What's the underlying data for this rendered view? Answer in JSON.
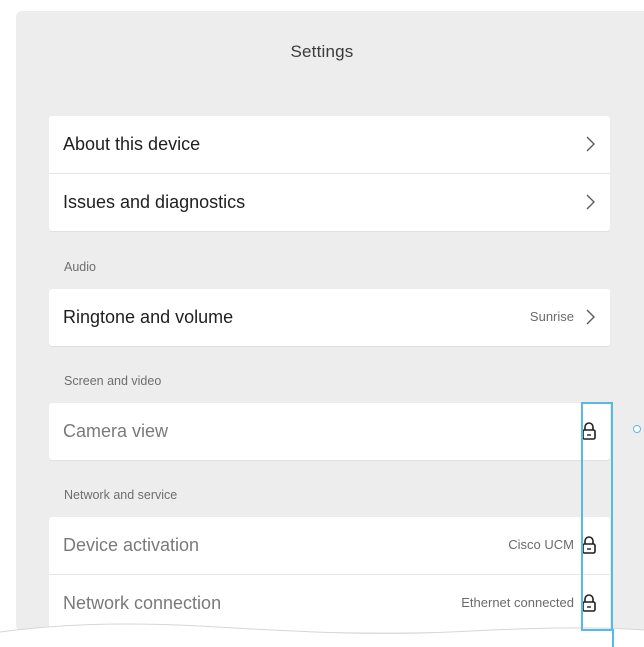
{
  "page_title": "Settings",
  "group_general": {
    "items": [
      {
        "label": "About this device",
        "icon": "chevron-right-icon"
      },
      {
        "label": "Issues and diagnostics",
        "icon": "chevron-right-icon"
      }
    ]
  },
  "section_audio": {
    "heading": "Audio",
    "items": [
      {
        "label": "Ringtone and volume",
        "value": "Sunrise",
        "icon": "chevron-right-icon"
      }
    ]
  },
  "section_screen": {
    "heading": "Screen and video",
    "items": [
      {
        "label": "Camera view",
        "icon": "lock-icon"
      }
    ]
  },
  "section_network": {
    "heading": "Network and service",
    "items": [
      {
        "label": "Device activation",
        "value": "Cisco UCM",
        "icon": "lock-icon"
      },
      {
        "label": "Network connection",
        "value": "Ethernet connected",
        "icon": "lock-icon"
      }
    ]
  },
  "colors": {
    "panel_background": "#ededed",
    "card_background": "#ffffff",
    "callout_accent": "#56b9e6",
    "disabled_text": "#7a7a7a"
  }
}
